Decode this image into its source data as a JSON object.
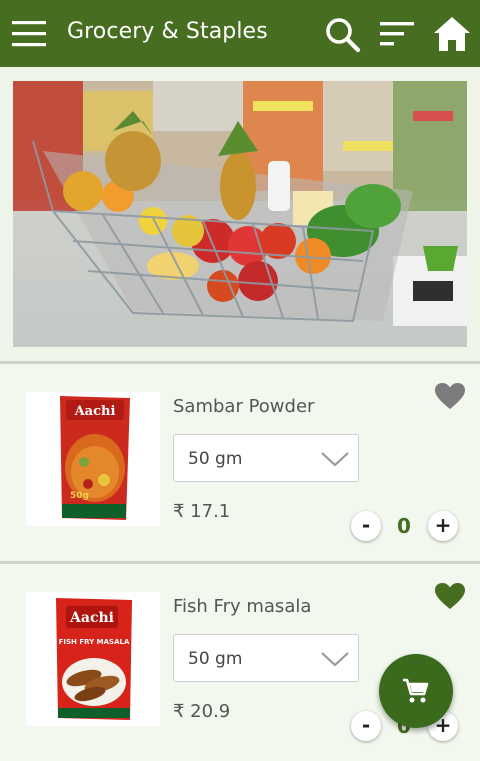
{
  "header": {
    "title": "Grocery & Staples",
    "icons": [
      "menu-icon",
      "search-icon",
      "sort-icon",
      "home-icon"
    ]
  },
  "colors": {
    "primary": "#466d20",
    "background": "#eef4e8",
    "card": "#f2f8ee"
  },
  "products": [
    {
      "name": "Sambar Powder",
      "pack_brand": "Aachi",
      "pack_size_text": "50g",
      "weight": "50 gm",
      "price": "₹ 17.1",
      "quantity": "0",
      "favorite": false
    },
    {
      "name": "Fish Fry masala",
      "pack_brand": "Aachi",
      "pack_size_text": "FISH FRY MASALA",
      "weight": "50 gm",
      "price": "₹ 20.9",
      "quantity": "0",
      "favorite": true
    }
  ],
  "controls": {
    "minus": "-",
    "plus": "+"
  },
  "fab": {
    "icon": "cart-icon"
  }
}
